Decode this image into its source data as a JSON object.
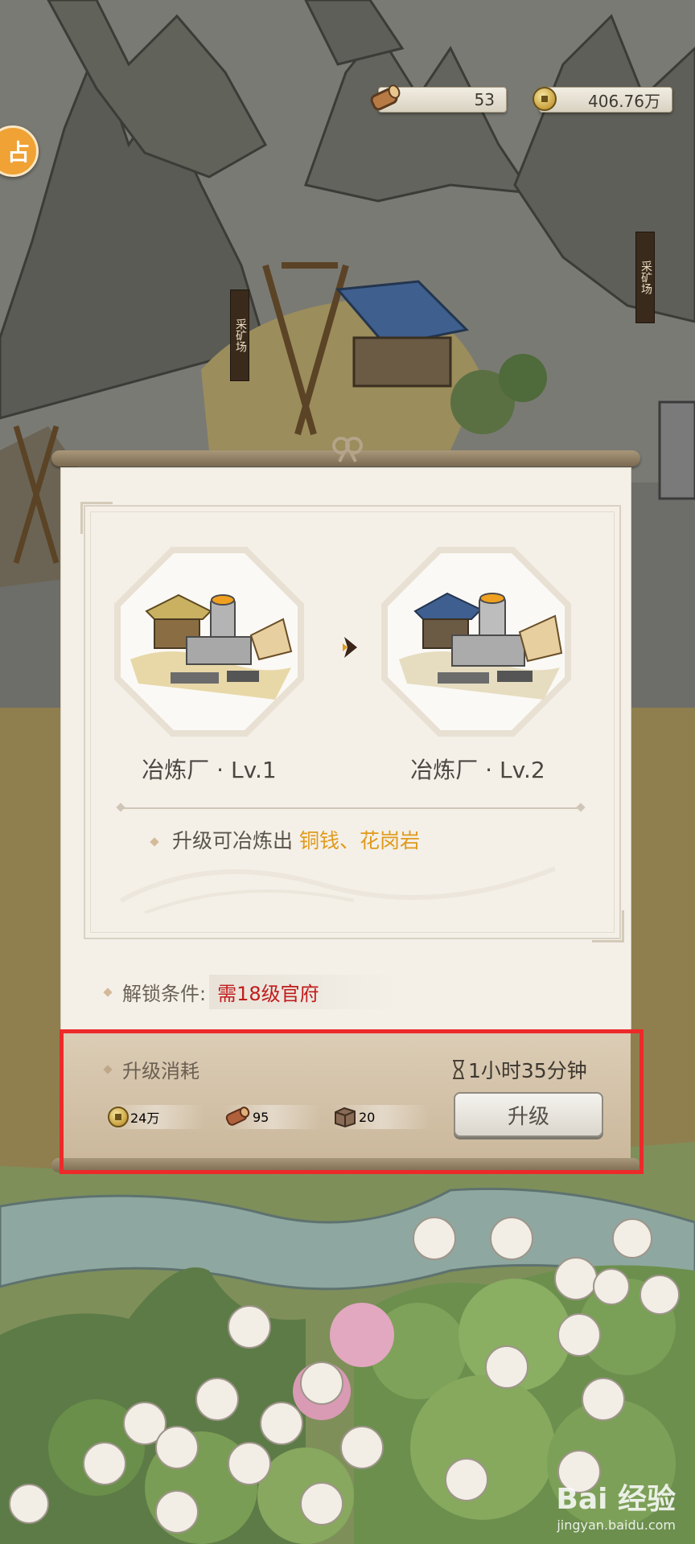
{
  "resources": {
    "wood": "53",
    "coins": "406.76万"
  },
  "map": {
    "left_button_glyph": "占",
    "mine_sign": "采矿场"
  },
  "panel": {
    "current": {
      "name": "冶炼厂 · Lv.1"
    },
    "next": {
      "name": "冶炼厂 · Lv.2"
    },
    "description_prefix": "升级可冶炼出 ",
    "description_highlight": "铜钱、花岗岩",
    "unlock_label": "解锁条件:",
    "unlock_value": "需18级官府",
    "cost_label": "升级消耗",
    "time": "1小时35分钟",
    "costs": [
      {
        "icon": "coin-icon",
        "value": "24万"
      },
      {
        "icon": "log-icon",
        "value": "95"
      },
      {
        "icon": "stone-block-icon",
        "value": "20"
      }
    ],
    "upgrade_button": "升级"
  },
  "watermark": {
    "brand": "Bai 经验",
    "url": "jingyan.baidu.com"
  }
}
